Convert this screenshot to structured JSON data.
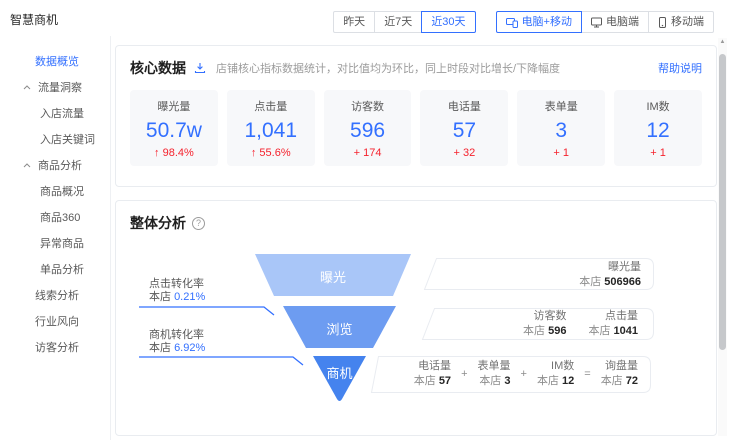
{
  "app": {
    "title": "智慧商机"
  },
  "colors": {
    "accent": "#3370ff",
    "up_red": "#f5222d"
  },
  "topbar": {
    "date_filters": [
      {
        "label": "昨天",
        "active": false
      },
      {
        "label": "近7天",
        "active": false
      },
      {
        "label": "近30天",
        "active": true
      }
    ],
    "device_filters": [
      {
        "label": "电脑+移动",
        "active": true
      },
      {
        "label": "电脑端",
        "active": false
      },
      {
        "label": "移动端",
        "active": false
      }
    ]
  },
  "sidebar": {
    "items": [
      {
        "label": "数据概览",
        "active": true
      },
      {
        "label": "流量洞察"
      },
      {
        "label": "入店流量"
      },
      {
        "label": "入店关键词"
      },
      {
        "label": "商品分析"
      },
      {
        "label": "商品概况"
      },
      {
        "label": "商品360"
      },
      {
        "label": "异常商品"
      },
      {
        "label": "单品分析"
      },
      {
        "label": "线索分析"
      },
      {
        "label": "行业风向"
      },
      {
        "label": "访客分析"
      }
    ]
  },
  "core": {
    "title": "核心数据",
    "description": "店铺核心指标数据统计，对比值均为环比，同上时段对比增长/下降幅度",
    "help_link": "帮助说明",
    "metrics": [
      {
        "label": "曝光量",
        "value": "50.7w",
        "change": "↑ 98.4%"
      },
      {
        "label": "点击量",
        "value": "1,041",
        "change": "↑ 55.6%"
      },
      {
        "label": "访客数",
        "value": "596",
        "change": "+ 174"
      },
      {
        "label": "电话量",
        "value": "57",
        "change": "+ 32"
      },
      {
        "label": "表单量",
        "value": "3",
        "change": "+ 1"
      },
      {
        "label": "IM数",
        "value": "12",
        "change": "+ 1"
      }
    ]
  },
  "overall": {
    "title": "整体分析",
    "funnel": {
      "type": "funnel",
      "segments": [
        {
          "label": "曝光",
          "color": "#a9c6f8"
        },
        {
          "label": "浏览",
          "color": "#6d9cf1"
        },
        {
          "label": "商机",
          "color": "#4583ee"
        }
      ]
    },
    "annotations": [
      {
        "label": "点击转化率",
        "store": "本店",
        "value": "0.21%"
      },
      {
        "label": "商机转化率",
        "store": "本店",
        "value": "6.92%"
      }
    ],
    "exposure_box": {
      "label": "曝光量",
      "store": "本店",
      "value": "506966"
    },
    "visit_box": [
      {
        "label": "访客数",
        "store": "本店",
        "value": "596"
      },
      {
        "label": "点击量",
        "store": "本店",
        "value": "1041"
      }
    ],
    "leads_box": {
      "items": [
        {
          "label": "电话量",
          "store": "本店",
          "value": "57"
        },
        {
          "label": "表单量",
          "store": "本店",
          "value": "3"
        },
        {
          "label": "IM数",
          "store": "本店",
          "value": "12"
        }
      ],
      "op_plus": "+",
      "op_eq": "=",
      "total": {
        "label": "询盘量",
        "store": "本店",
        "value": "72"
      }
    }
  }
}
